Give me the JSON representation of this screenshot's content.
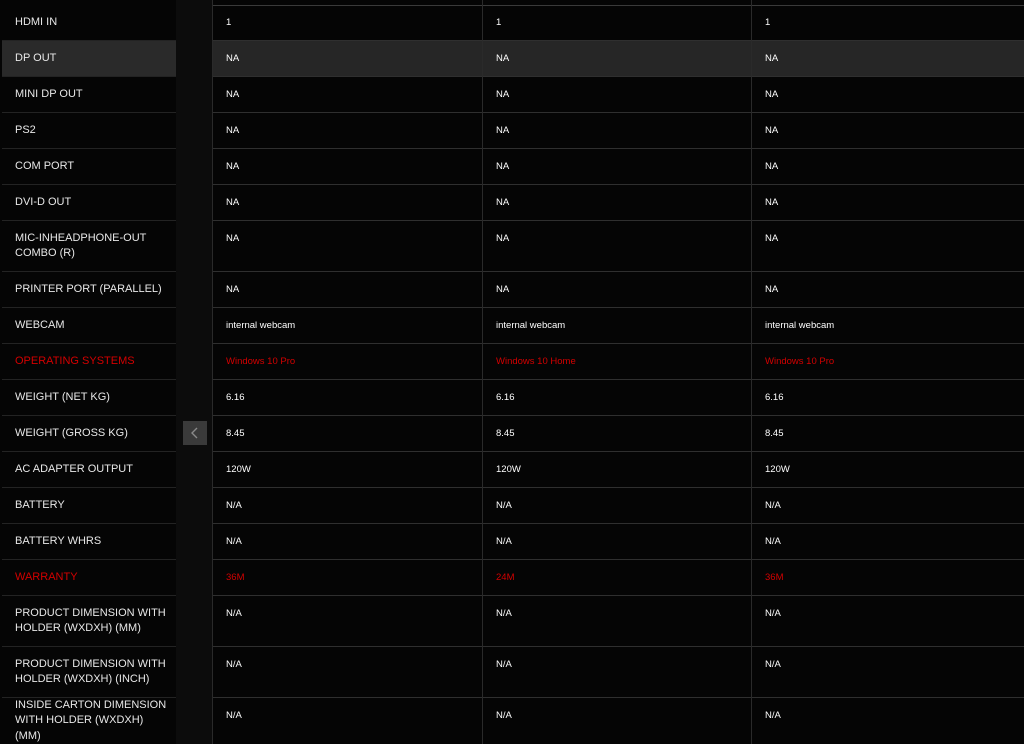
{
  "rows": [
    {
      "label": "HDMI IN",
      "values": [
        "1",
        "1",
        "1"
      ]
    },
    {
      "label": "DP OUT",
      "values": [
        "NA",
        "NA",
        "NA"
      ]
    },
    {
      "label": "MINI DP OUT",
      "values": [
        "NA",
        "NA",
        "NA"
      ]
    },
    {
      "label": "PS2",
      "values": [
        "NA",
        "NA",
        "NA"
      ]
    },
    {
      "label": "COM PORT",
      "values": [
        "NA",
        "NA",
        "NA"
      ]
    },
    {
      "label": "DVI-D OUT",
      "values": [
        "NA",
        "NA",
        "NA"
      ]
    },
    {
      "label": "MIC-INHEADPHONE-OUT COMBO (R)",
      "values": [
        "NA",
        "NA",
        "NA"
      ]
    },
    {
      "label": "PRINTER PORT (PARALLEL)",
      "values": [
        "NA",
        "NA",
        "NA"
      ]
    },
    {
      "label": "WEBCAM",
      "values": [
        "internal webcam",
        "internal webcam",
        "internal webcam"
      ]
    },
    {
      "label": "OPERATING SYSTEMS",
      "values": [
        "Windows 10 Pro",
        "Windows 10 Home",
        "Windows 10 Pro"
      ]
    },
    {
      "label": "WEIGHT (NET KG)",
      "values": [
        "6.16",
        "6.16",
        "6.16"
      ]
    },
    {
      "label": "WEIGHT (GROSS KG)",
      "values": [
        "8.45",
        "8.45",
        "8.45"
      ]
    },
    {
      "label": "AC ADAPTER OUTPUT",
      "values": [
        "120W",
        "120W",
        "120W"
      ]
    },
    {
      "label": "BATTERY",
      "values": [
        "N/A",
        "N/A",
        "N/A"
      ]
    },
    {
      "label": "BATTERY WHRS",
      "values": [
        "N/A",
        "N/A",
        "N/A"
      ]
    },
    {
      "label": "WARRANTY",
      "values": [
        "36M",
        "24M",
        "36M"
      ]
    },
    {
      "label": "PRODUCT DIMENSION WITH HOLDER (WXDXH) (MM)",
      "values": [
        "N/A",
        "N/A",
        "N/A"
      ]
    },
    {
      "label": "PRODUCT DIMENSION WITH HOLDER (WXDXH) (INCH)",
      "values": [
        "N/A",
        "N/A",
        "N/A"
      ]
    },
    {
      "label": "INSIDE CARTON DIMENSION WITH HOLDER (WXDXH) (MM)",
      "values": [
        "N/A",
        "N/A",
        "N/A"
      ]
    }
  ],
  "scroll_left_icon": "chevron-left-icon",
  "colors": {
    "accent_red": "#d40000",
    "highlight_row": "#262626"
  }
}
